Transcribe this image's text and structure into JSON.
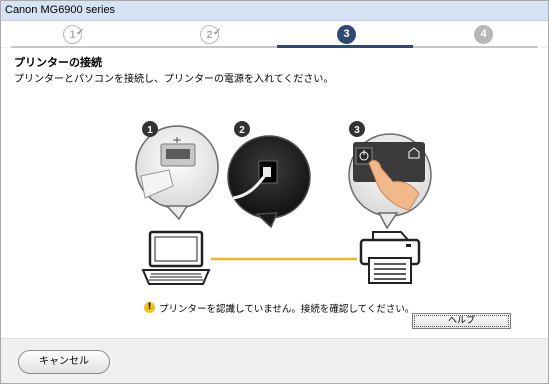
{
  "window": {
    "title": "Canon MG6900 series"
  },
  "steps": [
    {
      "number": "1",
      "state": "done"
    },
    {
      "number": "2",
      "state": "done"
    },
    {
      "number": "3",
      "state": "current"
    },
    {
      "number": "4",
      "state": "todo"
    }
  ],
  "content": {
    "heading": "プリンターの接続",
    "instruction": "プリンターとパソコンを接続し、プリンターの電源を入れてください。",
    "illustration_steps": [
      "1",
      "2",
      "3"
    ],
    "error_message": "プリンターを認識していません。接続を確認してください。",
    "help_label": "ヘルプ"
  },
  "footer": {
    "cancel_label": "キャンセル"
  },
  "colors": {
    "accent": "#2f4a72",
    "connection_line": "#f5b324",
    "warning": "#f2c21a"
  }
}
